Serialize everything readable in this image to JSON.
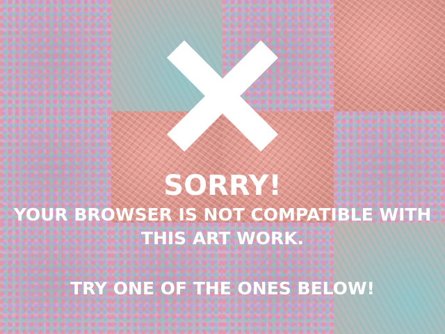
{
  "message": {
    "heading": "SORRY!",
    "line1": "YOUR BROWSER IS NOT COMPATIBLE WITH",
    "line2": "THIS ART WORK.",
    "suggestion": "TRY ONE OF THE ONES BELOW!"
  },
  "icons": {
    "error": "close-x-icon"
  },
  "colors": {
    "text": "#ffffff",
    "icon": "#ffffff",
    "salmon": "#d6877c",
    "teal": "#a9c2c2",
    "confetti": "#b7a8b8"
  }
}
